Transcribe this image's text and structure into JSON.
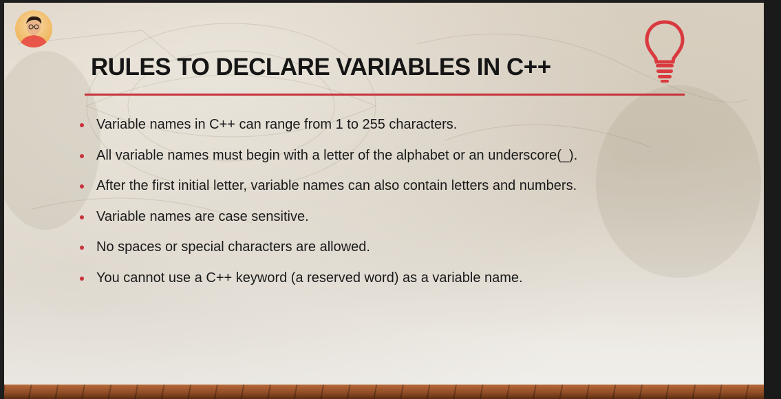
{
  "slide": {
    "title": "RULES TO DECLARE VARIABLES IN C++",
    "accent_color": "#c7323b",
    "icon": "lightbulb-icon",
    "bullets": [
      "Variable names in C++ can range from 1 to 255 characters.",
      "All variable names must begin with a letter of the alphabet or an underscore(_).",
      "After the first initial letter, variable names can also contain letters and numbers.",
      "Variable names are case sensitive.",
      "No spaces or special characters are allowed.",
      "You cannot use a C++ keyword (a reserved word) as a variable name."
    ]
  },
  "presenter": {
    "avatar_icon": "presenter-avatar"
  }
}
